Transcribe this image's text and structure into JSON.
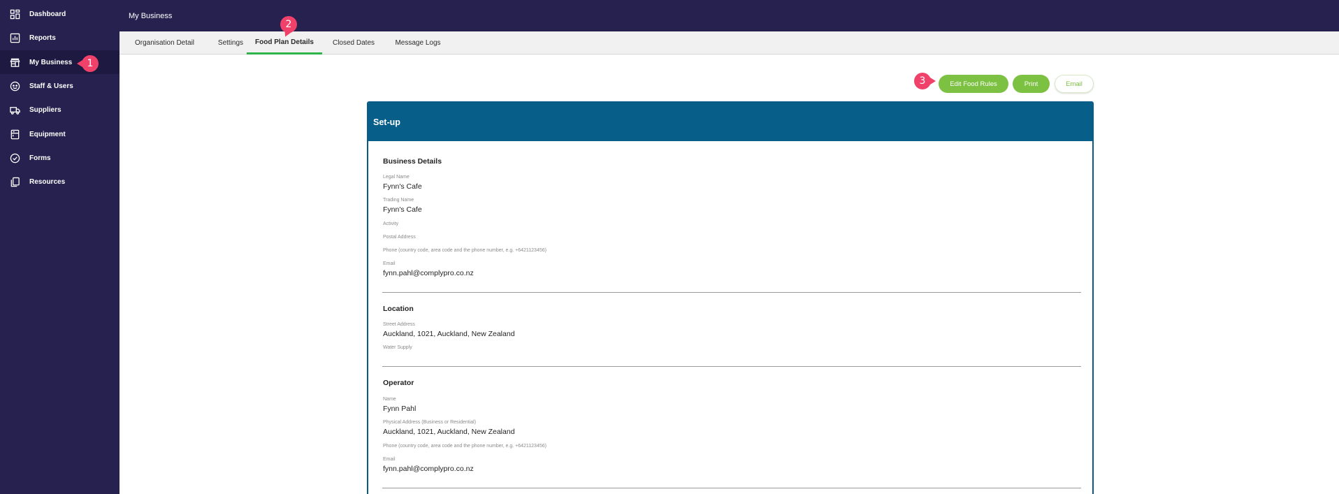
{
  "sidebar": {
    "items": [
      {
        "label": "Dashboard",
        "icon": "dashboard-icon"
      },
      {
        "label": "Reports",
        "icon": "reports-icon"
      },
      {
        "label": "My Business",
        "icon": "store-icon",
        "active": true
      },
      {
        "label": "Staff & Users",
        "icon": "smile-icon"
      },
      {
        "label": "Suppliers",
        "icon": "truck-icon"
      },
      {
        "label": "Equipment",
        "icon": "equipment-icon"
      },
      {
        "label": "Forms",
        "icon": "check-circle-icon"
      },
      {
        "label": "Resources",
        "icon": "copy-icon"
      }
    ]
  },
  "header": {
    "title": "My Business"
  },
  "tabs": [
    {
      "label": "Organisation Detail"
    },
    {
      "label": "Settings"
    },
    {
      "label": "Food Plan Details",
      "active": true
    },
    {
      "label": "Closed Dates"
    },
    {
      "label": "Message Logs"
    }
  ],
  "actions": {
    "edit_food_rules": "Edit Food Rules",
    "print": "Print",
    "email": "Email"
  },
  "markers": [
    "1",
    "2",
    "3"
  ],
  "card": {
    "title": "Set-up",
    "business_details": {
      "title": "Business Details",
      "legal_name_label": "Legal Name",
      "legal_name": "Fynn's Cafe",
      "trading_name_label": "Trading Name",
      "trading_name": "Fynn's Cafe",
      "activity_label": "Activity",
      "postal_address_label": "Postal Address",
      "phone_label": "Phone (country code, area code and the phone number, e.g. +6421123456)",
      "email_label": "Email",
      "email": "fynn.pahl@complypro.co.nz"
    },
    "location": {
      "title": "Location",
      "street_address_label": "Street Address",
      "street_address": "Auckland, 1021, Auckland, New Zealand",
      "water_supply_label": "Water Supply"
    },
    "operator": {
      "title": "Operator",
      "name_label": "Name",
      "name": "Fynn Pahl",
      "physical_address_label": "Physical Address (Business or Residential)",
      "physical_address": "Auckland, 1021, Auckland, New Zealand",
      "phone_label": "Phone (country code, area code and the phone number, e.g. +6421123456)",
      "email_label": "Email",
      "email": "fynn.pahl@complypro.co.nz"
    }
  },
  "colors": {
    "sidebar_bg": "#26214f",
    "accent_green": "#7cc142",
    "tab_underline": "#2fb44b",
    "card_header": "#065e89",
    "marker": "#f0416a"
  }
}
